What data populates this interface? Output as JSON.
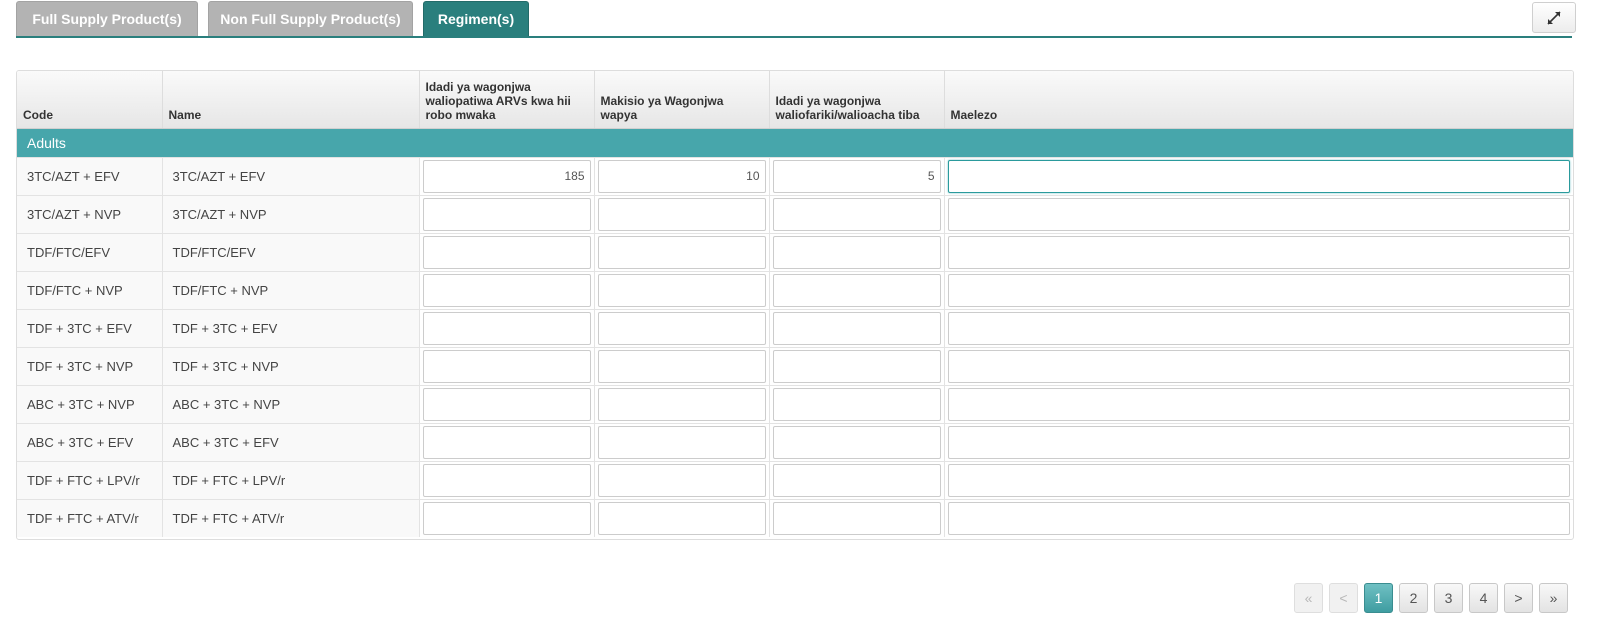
{
  "tabs": [
    {
      "label": "Full Supply Product(s)",
      "active": false
    },
    {
      "label": "Non Full Supply Product(s)",
      "active": false
    },
    {
      "label": "Regimen(s)",
      "active": true
    }
  ],
  "expand_icon": "expand-arrows-icon",
  "table": {
    "columns": [
      "Code",
      "Name",
      "Idadi ya wagonjwa waliopatiwa ARVs kwa hii robo mwaka",
      "Makisio ya Wagonjwa wapya",
      "Idadi ya wagonjwa waliofariki/walioacha tiba",
      "Maelezo"
    ],
    "group": "Adults",
    "rows": [
      {
        "code": "3TC/AZT + EFV",
        "name": "3TC/AZT + EFV",
        "patients": "185",
        "new_patients": "10",
        "lost": "5",
        "remarks": ""
      },
      {
        "code": "3TC/AZT + NVP",
        "name": "3TC/AZT + NVP",
        "patients": "",
        "new_patients": "",
        "lost": "",
        "remarks": ""
      },
      {
        "code": "TDF/FTC/EFV",
        "name": "TDF/FTC/EFV",
        "patients": "",
        "new_patients": "",
        "lost": "",
        "remarks": ""
      },
      {
        "code": "TDF/FTC + NVP",
        "name": "TDF/FTC + NVP",
        "patients": "",
        "new_patients": "",
        "lost": "",
        "remarks": ""
      },
      {
        "code": "TDF + 3TC + EFV",
        "name": "TDF + 3TC + EFV",
        "patients": "",
        "new_patients": "",
        "lost": "",
        "remarks": ""
      },
      {
        "code": "TDF + 3TC + NVP",
        "name": "TDF + 3TC + NVP",
        "patients": "",
        "new_patients": "",
        "lost": "",
        "remarks": ""
      },
      {
        "code": "ABC + 3TC + NVP",
        "name": "ABC + 3TC + NVP",
        "patients": "",
        "new_patients": "",
        "lost": "",
        "remarks": ""
      },
      {
        "code": "ABC + 3TC + EFV",
        "name": "ABC + 3TC + EFV",
        "patients": "",
        "new_patients": "",
        "lost": "",
        "remarks": ""
      },
      {
        "code": "TDF + FTC + LPV/r",
        "name": "TDF + FTC + LPV/r",
        "patients": "",
        "new_patients": "",
        "lost": "",
        "remarks": ""
      },
      {
        "code": "TDF + FTC + ATV/r",
        "name": "TDF + FTC + ATV/r",
        "patients": "",
        "new_patients": "",
        "lost": "",
        "remarks": ""
      }
    ]
  },
  "pagination": {
    "first": "«",
    "prev": "<",
    "pages": [
      "1",
      "2",
      "3",
      "4"
    ],
    "current": "1",
    "next": ">",
    "last": "»"
  },
  "colors": {
    "accent": "#2a7f7d",
    "group_row": "#47a6ab",
    "inactive_tab": "#b3b3b3"
  }
}
